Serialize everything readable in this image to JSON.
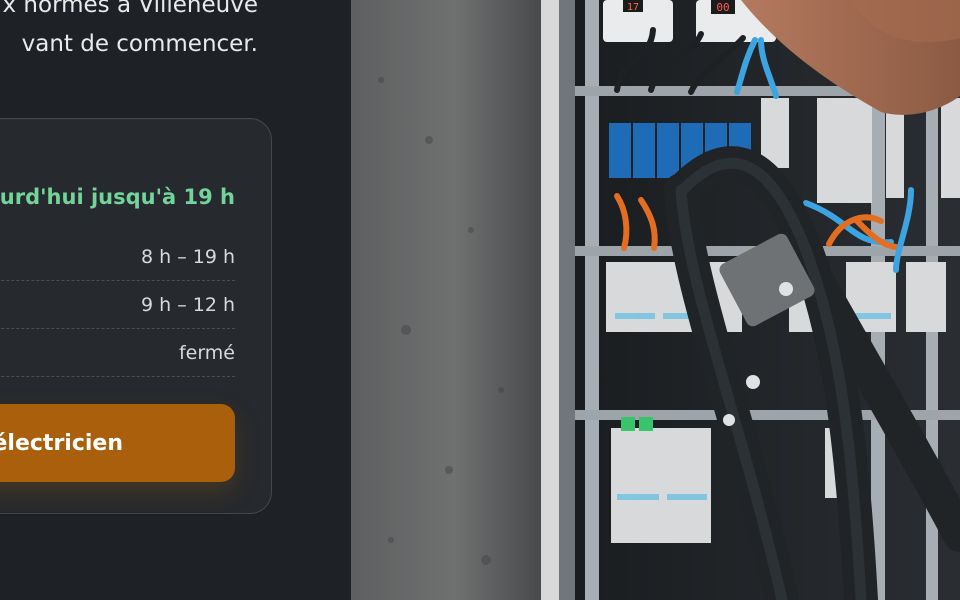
{
  "intro": {
    "line1": "x normes à Villeneuve",
    "line2": "vant de commencer."
  },
  "hours": {
    "status": "urd'hui jusqu'à 19 h",
    "rows": [
      {
        "value": "8 h – 19 h"
      },
      {
        "value": "9 h – 12 h"
      },
      {
        "value": "fermé"
      }
    ]
  },
  "cta": {
    "label": "électricien"
  },
  "photo": {
    "display_left": "17",
    "display_right": "00"
  },
  "colors": {
    "background": "#1e2125",
    "card": "#26292d",
    "status_green": "#73d39a",
    "cta_orange": "#a95f0b"
  }
}
